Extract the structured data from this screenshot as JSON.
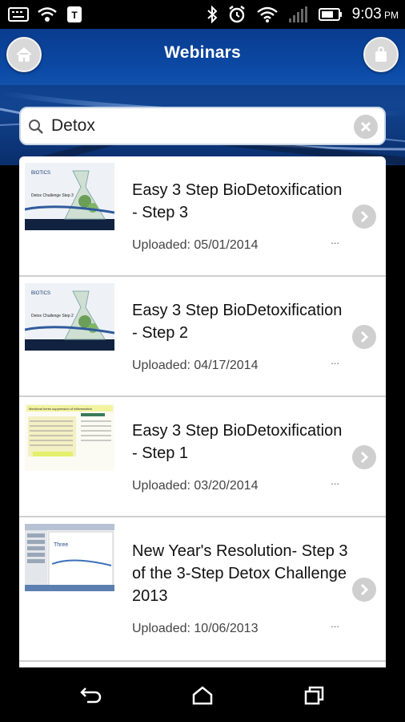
{
  "status_bar": {
    "time": "9:03",
    "ampm": "PM"
  },
  "header": {
    "title": "Webinars"
  },
  "search": {
    "value": "Detox",
    "placeholder": ""
  },
  "items": [
    {
      "title": "Easy 3 Step BioDetoxification - Step 3",
      "date": "Uploaded: 05/01/2014",
      "more": "..."
    },
    {
      "title": "Easy 3 Step BioDetoxification - Step 2",
      "date": "Uploaded: 04/17/2014",
      "more": "..."
    },
    {
      "title": "Easy 3 Step BioDetoxification - Step 1",
      "date": "Uploaded: 03/20/2014",
      "more": "..."
    },
    {
      "title": "New Year's Resolution- Step 3 of the 3-Step Detox Challenge 2013",
      "date": "Uploaded: 10/06/2013",
      "more": "..."
    }
  ],
  "thumbnails": [
    {
      "brand": "BIOTICS",
      "caption": "Detox Challenge Step 3"
    },
    {
      "brand": "BIOTICS",
      "caption": "Detox Challenge Step 2"
    },
    {
      "heading": "Medicinal herbs suppression of inflammation"
    },
    {
      "heading": "Three"
    }
  ],
  "colors": {
    "accent": "#0b4aa6",
    "list_bg": "#ffffff",
    "divider": "#cfcfcf"
  },
  "icons": [
    "home-icon",
    "shopping-bag-icon",
    "search-icon",
    "clear-icon",
    "chevron-right-icon",
    "back-icon",
    "nav-home-icon",
    "recent-apps-icon"
  ]
}
